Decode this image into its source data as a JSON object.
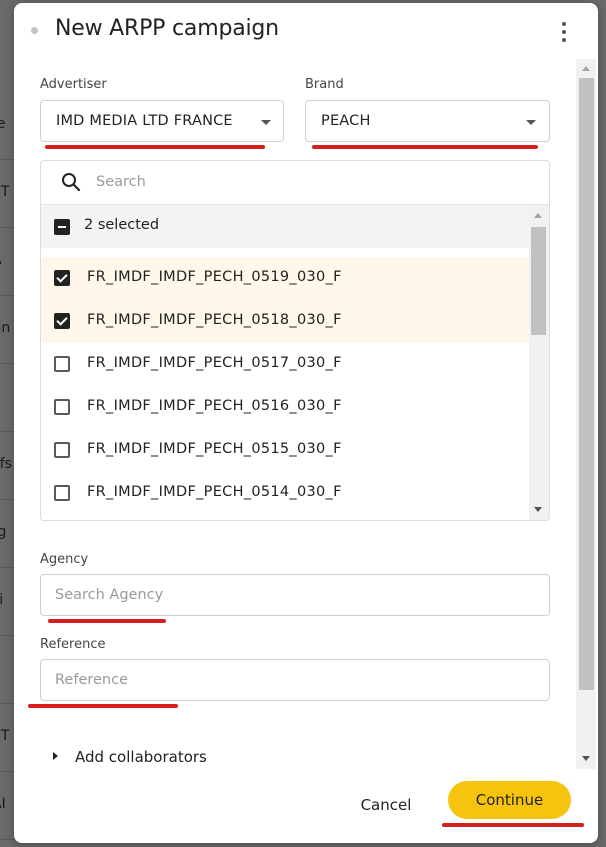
{
  "background": {
    "rows": [
      "fe",
      "ST",
      "A",
      "tin",
      "t",
      "cfs",
      "rg",
      "si",
      "t",
      "ST",
      "AI"
    ]
  },
  "dialog": {
    "title": "New ARPP campaign",
    "advertiser": {
      "label": "Advertiser",
      "value": "IMD MEDIA LTD FRANCE"
    },
    "brand": {
      "label": "Brand",
      "value": "PEACH"
    },
    "campaign_list": {
      "search_placeholder": "Search",
      "selected_summary": "2 selected",
      "items": [
        {
          "label": "FR_IMDF_IMDF_PECH_0519_030_F",
          "checked": true
        },
        {
          "label": "FR_IMDF_IMDF_PECH_0518_030_F",
          "checked": true
        },
        {
          "label": "FR_IMDF_IMDF_PECH_0517_030_F",
          "checked": false
        },
        {
          "label": "FR_IMDF_IMDF_PECH_0516_030_F",
          "checked": false
        },
        {
          "label": "FR_IMDF_IMDF_PECH_0515_030_F",
          "checked": false
        },
        {
          "label": "FR_IMDF_IMDF_PECH_0514_030_F",
          "checked": false
        }
      ]
    },
    "agency": {
      "label": "Agency",
      "placeholder": "Search Agency"
    },
    "reference": {
      "label": "Reference",
      "placeholder": "Reference"
    },
    "collaborators_label": "Add collaborators",
    "footer": {
      "cancel_label": "Cancel",
      "continue_label": "Continue"
    }
  },
  "colors": {
    "accent": "#f6c40f",
    "annotation_red": "#d61f1f",
    "selected_row_bg": "#fff7ea"
  },
  "icons": {
    "menu": "kebab-menu-icon",
    "search": "search-icon",
    "dropdown": "caret-down-icon",
    "expand": "caret-right-icon"
  }
}
